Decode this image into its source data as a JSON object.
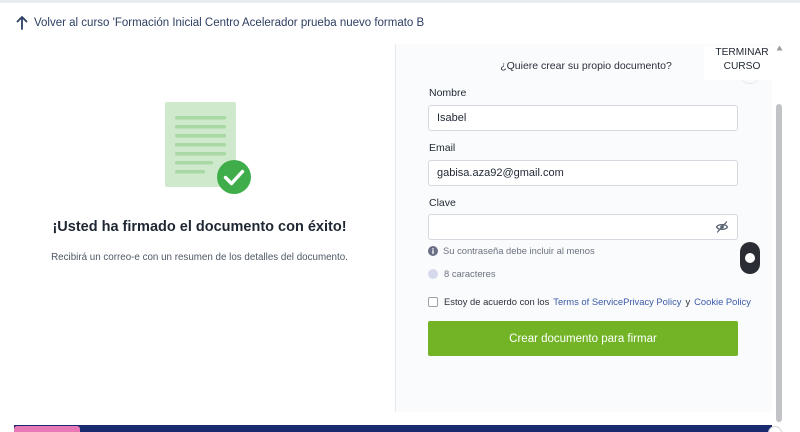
{
  "nav": {
    "back_link": "Volver al curso 'Formación Inicial Centro Acelerador prueba nuevo formato B"
  },
  "success": {
    "title": "¡Usted ha firmado el documento con éxito!",
    "subtitle": "Recibirá un correo-e con un resumen de los detalles del documento."
  },
  "form": {
    "question": "¿Quiere crear su propio documento?",
    "name_label": "Nombre",
    "name_value": "Isabel",
    "email_label": "Email",
    "email_value": "gabisa.aza92@gmail.com",
    "password_label": "Clave",
    "password_value": "",
    "hint_text": "Su contraseña debe incluir al menos",
    "hint_requirement": "8 caracteres",
    "terms_prefix": "Estoy de acuerdo con los",
    "terms_of_service": "Terms of Service",
    "privacy_policy": "Privacy Policy",
    "terms_and": "y",
    "cookie_policy": "Cookie Policy",
    "submit_label": "Crear documento para firmar"
  },
  "controls": {
    "terminar_line1": "TERMINAR",
    "terminar_line2": "CURSO"
  },
  "colors": {
    "primary_button": "#72b425",
    "success_check": "#3fae4a",
    "link": "#3a5aa8",
    "bottom_bar": "#1a2a6e"
  },
  "icons": {
    "back": "arrow-up-icon",
    "document": "document-icon",
    "check": "check-circle-icon",
    "eye": "eye-slash-icon",
    "info": "info-icon"
  }
}
